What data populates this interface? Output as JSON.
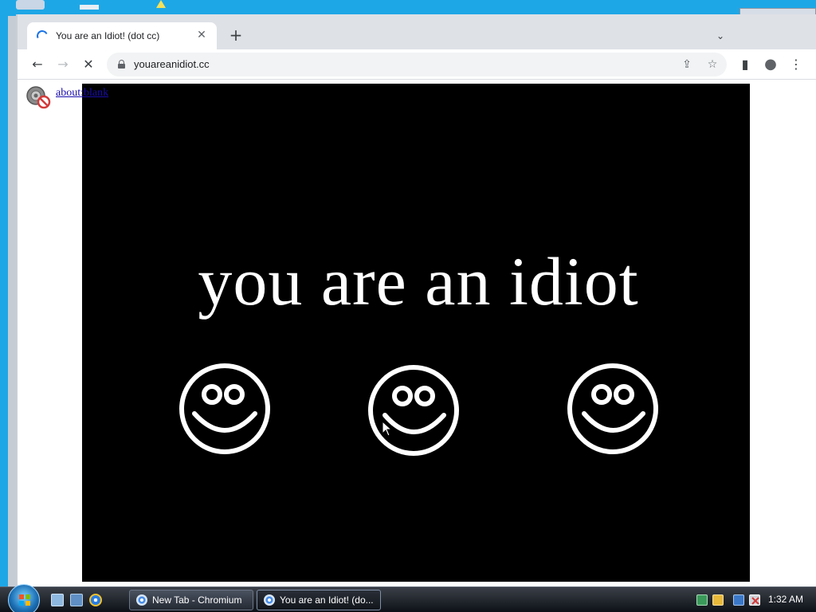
{
  "browser": {
    "tab": {
      "title": "You are an Idiot! (dot cc)",
      "close_glyph": "✕",
      "icon": "loading-spinner-icon"
    },
    "new_tab_glyph": "+",
    "tab_search_glyph": "⌄",
    "toolbar": {
      "back_glyph": "←",
      "forward_glyph": "→",
      "stop_glyph": "✕",
      "url": "youareanidiot.cc",
      "share_glyph": "⇪",
      "bookmark_glyph": "☆",
      "sidebar_glyph": "▮",
      "profile_glyph": "●",
      "menu_glyph": "⋮"
    }
  },
  "page": {
    "about_link": "about:blank",
    "slogan": "you are an idiot",
    "smileys": [
      "smiley-face-icon",
      "smiley-face-icon",
      "smiley-face-icon"
    ]
  },
  "background_window": {
    "min_glyph": "—",
    "max_glyph": "❐",
    "close_glyph": "✕"
  },
  "taskbar": {
    "buttons": [
      {
        "label": "New Tab - Chromium",
        "active": false
      },
      {
        "label": "You are an Idiot! (do...",
        "active": true
      }
    ],
    "clock": "1:32 AM"
  },
  "colors": {
    "desktop": "#1ea7e6",
    "video_bg": "#000000",
    "chrome_accent": "#1a73e8"
  }
}
